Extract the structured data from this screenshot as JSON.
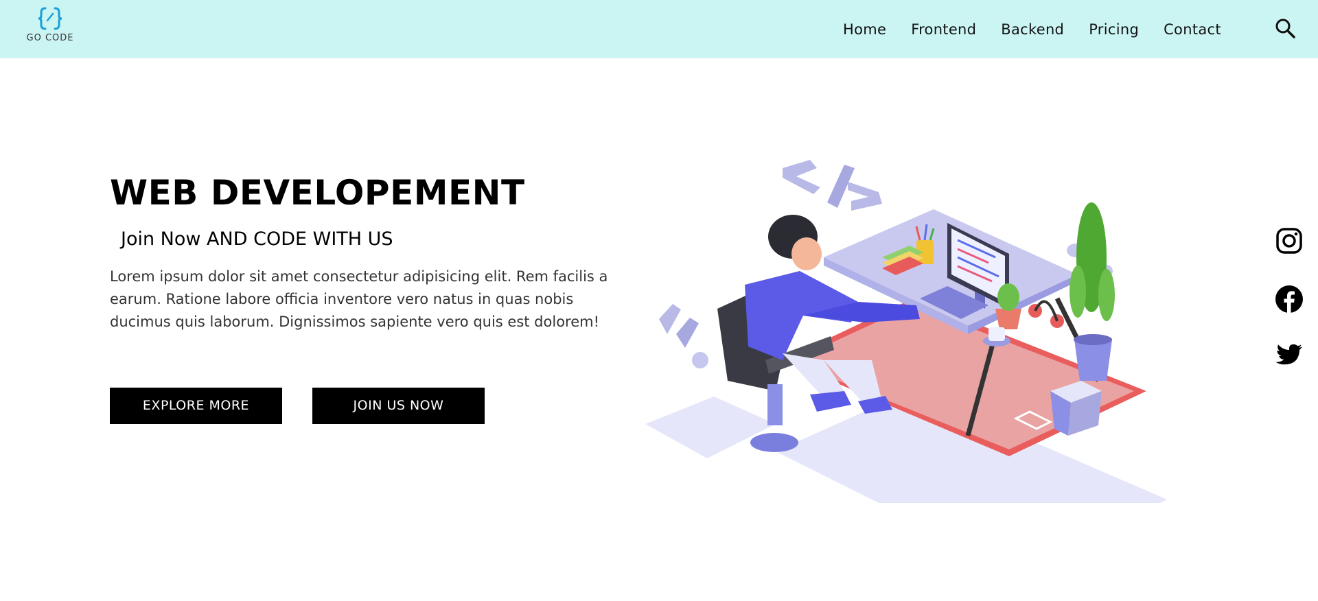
{
  "brand": {
    "name": "GO CODE",
    "accent": "#1a9fd6"
  },
  "nav": {
    "background": "#cbf5f3",
    "items": [
      {
        "label": "Home"
      },
      {
        "label": "Frontend"
      },
      {
        "label": "Backend"
      },
      {
        "label": "Pricing"
      },
      {
        "label": "Contact"
      }
    ],
    "search_icon": "search-icon"
  },
  "hero": {
    "title": "WEB DEVELOPEMENT",
    "subtitle": "Join Now AND CODE WITH US",
    "body": "Lorem ipsum dolor sit amet consectetur adipisicing elit. Rem facilis a earum. Ratione labore officia inventore vero natus in quas nobis ducimus quis laborum. Dignissimos sapiente vero quis est dolorem!",
    "primary_button": "EXPLORE MORE",
    "secondary_button": "JOIN US NOW",
    "button_color": "#000000"
  },
  "illustration": {
    "icon": "developer-at-desk-illustration"
  },
  "social": [
    {
      "icon": "instagram-icon"
    },
    {
      "icon": "facebook-icon"
    },
    {
      "icon": "twitter-icon"
    }
  ]
}
